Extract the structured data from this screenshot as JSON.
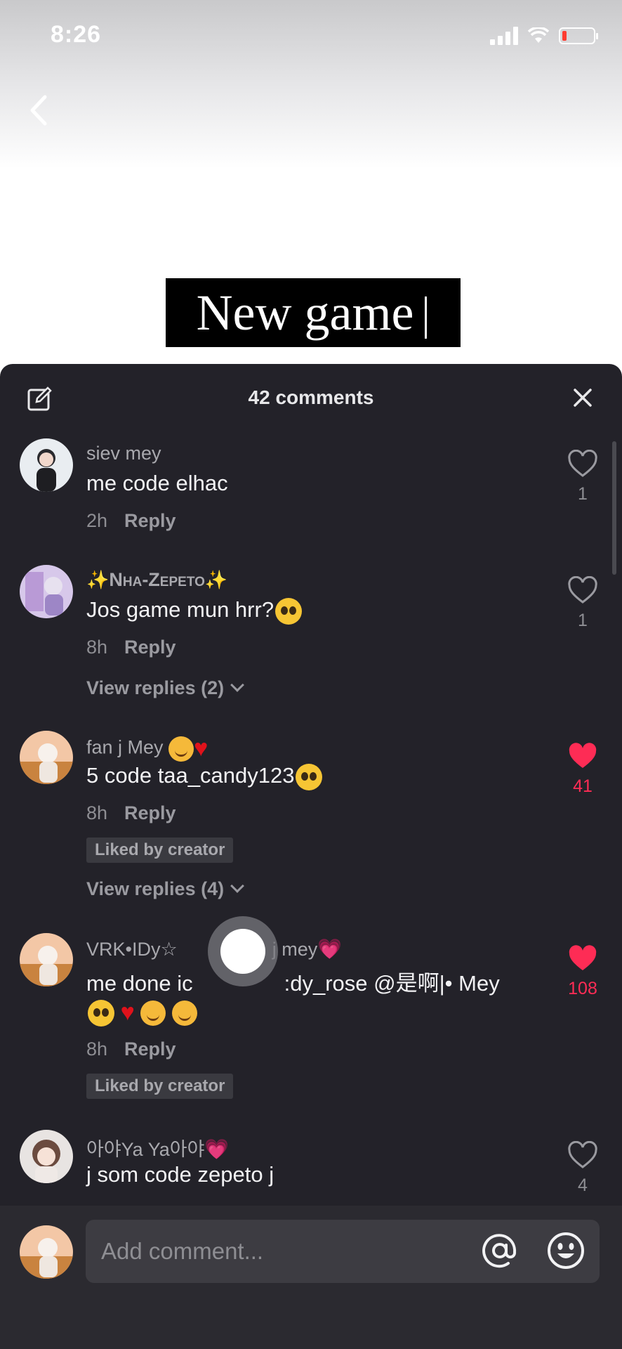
{
  "status_bar": {
    "time": "8:26"
  },
  "video": {
    "title": "New game"
  },
  "comments_panel": {
    "title": "42 comments",
    "comments": [
      {
        "username": "siev mey",
        "text": "me code elhac",
        "time": "2h",
        "reply": "Reply",
        "likes": "1",
        "liked": false
      },
      {
        "username": "Nha-Zepeto",
        "text": "Jos game mun hrr?",
        "time": "8h",
        "reply": "Reply",
        "likes": "1",
        "liked": false,
        "view_replies": "View replies (2)"
      },
      {
        "username": "fan j Mey",
        "text": "5 code taa_candy123",
        "time": "8h",
        "reply": "Reply",
        "likes": "41",
        "liked": true,
        "badge": "Liked by creator",
        "view_replies": "View replies (4)"
      },
      {
        "username_left": "VRK•IDy☆",
        "username_right": "j mey",
        "text_left": "me done ic",
        "text_right": ":dy_rose @是啊|• Mey",
        "time": "8h",
        "reply": "Reply",
        "likes": "108",
        "liked": true,
        "badge": "Liked by creator"
      },
      {
        "username": "아야Ya Ya아야",
        "text": "j som code zepeto j",
        "likes": "4",
        "liked": false
      }
    ]
  },
  "input": {
    "placeholder": "Add comment..."
  },
  "colors": {
    "panel_bg": "#232229",
    "like_red": "#fe2c55"
  },
  "icons": [
    "back-arrow-icon",
    "edit-icon",
    "close-icon",
    "heart-icon",
    "at-icon",
    "emoji-icon"
  ]
}
